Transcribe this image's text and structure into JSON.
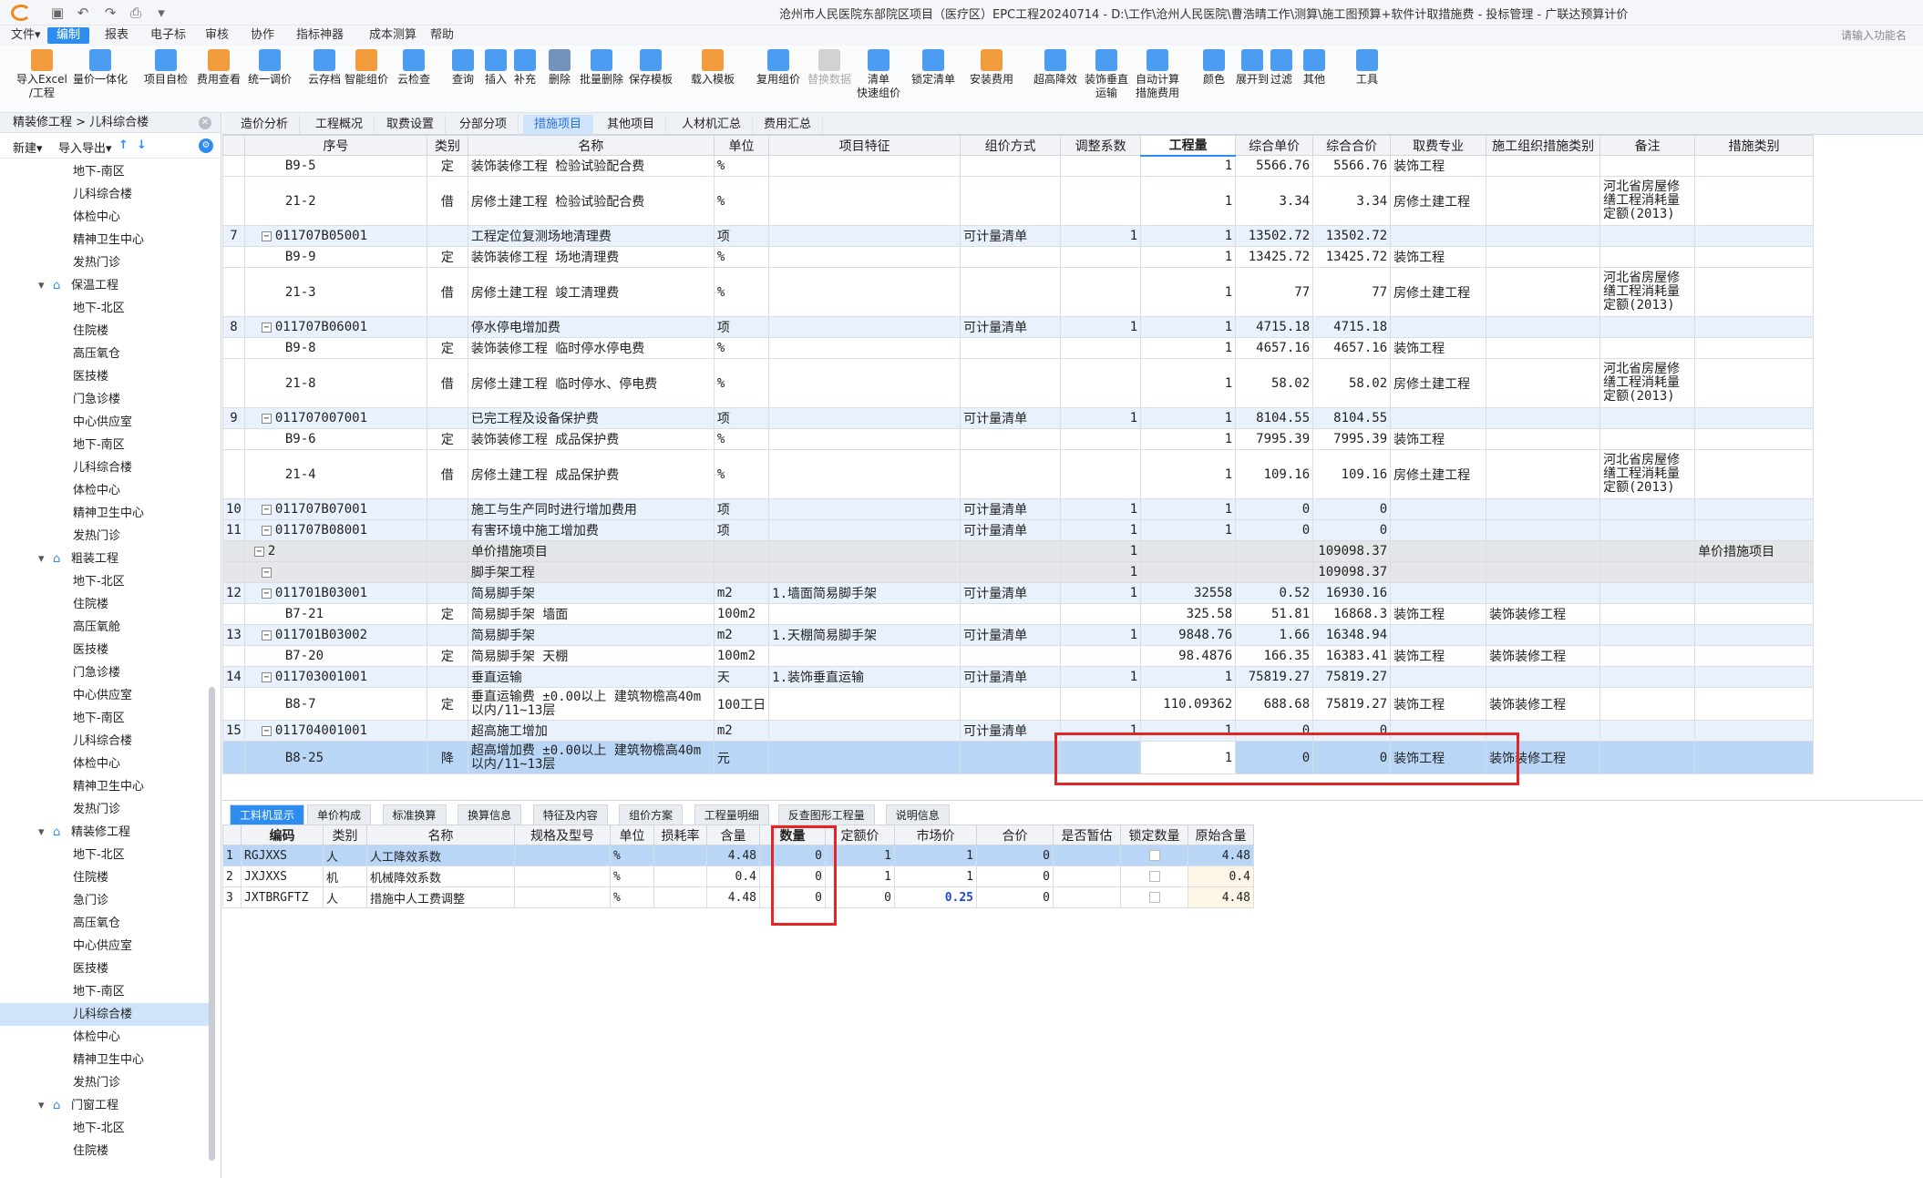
{
  "window": {
    "title": "沧州市人民医院东部院区项目（医疗区）EPC工程20240714 - D:\\工作\\沧州人民医院\\曹浩晴工作\\测算\\施工图预算+软件计取措施费 - 投标管理 - 广联达预算计价",
    "search_placeholder": "请输入功能名"
  },
  "colors": {
    "accent": "#2d8cf0",
    "highlight": "#e32525",
    "selected_row": "#b9d6f6",
    "list_row": "#e8f1fc"
  },
  "menu": [
    "文件▾",
    "编制",
    "报表",
    "电子标",
    "审核",
    "协作",
    "指标神器",
    "成本测算",
    "帮助"
  ],
  "ribbon": [
    {
      "label": "导入Excel",
      "label2": "/工程",
      "icon": "import-icon"
    },
    {
      "label": "量价一体化",
      "label2": "",
      "icon": "qty-price-icon"
    },
    {
      "label": "项目自检",
      "label2": "",
      "icon": "self-check-icon"
    },
    {
      "label": "费用查看",
      "label2": "",
      "icon": "fee-view-icon"
    },
    {
      "label": "统一调价",
      "label2": "",
      "icon": "unify-price-icon"
    },
    {
      "label": "云存档",
      "label2": "",
      "icon": "cloud-save-icon"
    },
    {
      "label": "智能组价",
      "label2": "",
      "icon": "smart-price-icon"
    },
    {
      "label": "云检查",
      "label2": "",
      "icon": "cloud-check-icon"
    },
    {
      "label": "查询",
      "label2": "",
      "icon": "query-icon"
    },
    {
      "label": "插入",
      "label2": "",
      "icon": "insert-icon"
    },
    {
      "label": "补充",
      "label2": "",
      "icon": "supplement-icon"
    },
    {
      "label": "删除",
      "label2": "",
      "icon": "delete-icon"
    },
    {
      "label": "批量删除",
      "label2": "",
      "icon": "batch-delete-icon"
    },
    {
      "label": "保存模板",
      "label2": "",
      "icon": "save-template-icon"
    },
    {
      "label": "载入模板",
      "label2": "",
      "icon": "load-template-icon"
    },
    {
      "label": "复用组价",
      "label2": "",
      "icon": "reuse-price-icon"
    },
    {
      "label": "替换数据",
      "label2": "",
      "icon": "replace-data-icon",
      "disabled": true
    },
    {
      "label": "清单",
      "label2": "快速组价",
      "icon": "list-quick-icon"
    },
    {
      "label": "锁定清单",
      "label2": "",
      "icon": "lock-list-icon"
    },
    {
      "label": "安装费用",
      "label2": "",
      "icon": "install-fee-icon"
    },
    {
      "label": "超高降效",
      "label2": "",
      "icon": "height-reduce-icon"
    },
    {
      "label": "装饰垂直",
      "label2": "运输",
      "icon": "vertical-transport-icon"
    },
    {
      "label": "自动计算",
      "label2": "措施费用",
      "icon": "auto-calc-icon"
    },
    {
      "label": "颜色",
      "label2": "",
      "icon": "color-icon"
    },
    {
      "label": "展开到",
      "label2": "",
      "icon": "expand-to-icon"
    },
    {
      "label": "过滤",
      "label2": "",
      "icon": "filter-icon"
    },
    {
      "label": "其他",
      "label2": "",
      "icon": "other-icon"
    },
    {
      "label": "工具",
      "label2": "",
      "icon": "tools-icon"
    }
  ],
  "left": {
    "breadcrumb": "精装修工程 > 儿科综合楼",
    "new_label": "新建▾",
    "import_export_label": "导入导出▾",
    "tree": [
      {
        "label": "地下-南区",
        "level": 2
      },
      {
        "label": "儿科综合楼",
        "level": 2
      },
      {
        "label": "体检中心",
        "level": 2
      },
      {
        "label": "精神卫生中心",
        "level": 2
      },
      {
        "label": "发热门诊",
        "level": 2
      },
      {
        "label": "保温工程",
        "level": 1
      },
      {
        "label": "地下-北区",
        "level": 2
      },
      {
        "label": "住院楼",
        "level": 2
      },
      {
        "label": "高压氧仓",
        "level": 2
      },
      {
        "label": "医技楼",
        "level": 2
      },
      {
        "label": "门急诊楼",
        "level": 2
      },
      {
        "label": "中心供应室",
        "level": 2
      },
      {
        "label": "地下-南区",
        "level": 2
      },
      {
        "label": "儿科综合楼",
        "level": 2
      },
      {
        "label": "体检中心",
        "level": 2
      },
      {
        "label": "精神卫生中心",
        "level": 2
      },
      {
        "label": "发热门诊",
        "level": 2
      },
      {
        "label": "粗装工程",
        "level": 1
      },
      {
        "label": "地下-北区",
        "level": 2
      },
      {
        "label": "住院楼",
        "level": 2
      },
      {
        "label": "高压氧舱",
        "level": 2
      },
      {
        "label": "医技楼",
        "level": 2
      },
      {
        "label": "门急诊楼",
        "level": 2
      },
      {
        "label": "中心供应室",
        "level": 2
      },
      {
        "label": "地下-南区",
        "level": 2
      },
      {
        "label": "儿科综合楼",
        "level": 2
      },
      {
        "label": "体检中心",
        "level": 2
      },
      {
        "label": "精神卫生中心",
        "level": 2
      },
      {
        "label": "发热门诊",
        "level": 2
      },
      {
        "label": "精装修工程",
        "level": 1
      },
      {
        "label": "地下-北区",
        "level": 2
      },
      {
        "label": "住院楼",
        "level": 2
      },
      {
        "label": "急门诊",
        "level": 2
      },
      {
        "label": "高压氧仓",
        "level": 2
      },
      {
        "label": "中心供应室",
        "level": 2
      },
      {
        "label": "医技楼",
        "level": 2
      },
      {
        "label": "地下-南区",
        "level": 2
      },
      {
        "label": "儿科综合楼",
        "level": 2,
        "selected": true
      },
      {
        "label": "体检中心",
        "level": 2
      },
      {
        "label": "精神卫生中心",
        "level": 2
      },
      {
        "label": "发热门诊",
        "level": 2
      },
      {
        "label": "门窗工程",
        "level": 1
      },
      {
        "label": "地下-北区",
        "level": 2
      },
      {
        "label": "住院楼",
        "level": 2
      }
    ]
  },
  "tabs": [
    "造价分析",
    "工程概况",
    "取费设置",
    "分部分项",
    "措施项目",
    "其他项目",
    "人材机汇总",
    "费用汇总"
  ],
  "active_tab": 4,
  "grid": {
    "headers": [
      "序号",
      "类别",
      "名称",
      "单位",
      "项目特征",
      "组价方式",
      "调整系数",
      "工程量",
      "综合单价",
      "综合合价",
      "取费专业",
      "施工组织措施类别",
      "备注",
      "措施类别"
    ],
    "rows": [
      {
        "type": "item",
        "seq": "",
        "code": "B9-5",
        "cat": "定",
        "name": "装饰装修工程 检验试验配合费",
        "unit": "%",
        "feat": "",
        "method": "",
        "coef": "",
        "qty": "1",
        "uprice": "5566.76",
        "total": "5566.76",
        "major": "装饰工程",
        "org": "",
        "note": "",
        "mcat": ""
      },
      {
        "type": "item",
        "seq": "",
        "code": "21-2",
        "cat": "借",
        "name": "房修土建工程 检验试验配合费",
        "unit": "%",
        "feat": "",
        "method": "",
        "coef": "",
        "qty": "1",
        "uprice": "3.34",
        "total": "3.34",
        "major": "房修土建工程",
        "org": "",
        "note": "河北省房屋修缮工程消耗量定额(2013)",
        "mcat": "",
        "tall": true
      },
      {
        "type": "list",
        "seq": "7",
        "code": "011707B05001",
        "cat": "",
        "name": "工程定位复测场地清理费",
        "unit": "项",
        "feat": "",
        "method": "可计量清单",
        "coef": "1",
        "qty": "1",
        "uprice": "13502.72",
        "total": "13502.72",
        "major": "",
        "org": "",
        "note": "",
        "mcat": ""
      },
      {
        "type": "item",
        "seq": "",
        "code": "B9-9",
        "cat": "定",
        "name": "装饰装修工程 场地清理费",
        "unit": "%",
        "feat": "",
        "method": "",
        "coef": "",
        "qty": "1",
        "uprice": "13425.72",
        "total": "13425.72",
        "major": "装饰工程",
        "org": "",
        "note": "",
        "mcat": ""
      },
      {
        "type": "item",
        "seq": "",
        "code": "21-3",
        "cat": "借",
        "name": "房修土建工程 竣工清理费",
        "unit": "%",
        "feat": "",
        "method": "",
        "coef": "",
        "qty": "1",
        "uprice": "77",
        "total": "77",
        "major": "房修土建工程",
        "org": "",
        "note": "河北省房屋修缮工程消耗量定额(2013)",
        "mcat": "",
        "tall": true
      },
      {
        "type": "list",
        "seq": "8",
        "code": "011707B06001",
        "cat": "",
        "name": "停水停电增加费",
        "unit": "项",
        "feat": "",
        "method": "可计量清单",
        "coef": "1",
        "qty": "1",
        "uprice": "4715.18",
        "total": "4715.18",
        "major": "",
        "org": "",
        "note": "",
        "mcat": ""
      },
      {
        "type": "item",
        "seq": "",
        "code": "B9-8",
        "cat": "定",
        "name": "装饰装修工程 临时停水停电费",
        "unit": "%",
        "feat": "",
        "method": "",
        "coef": "",
        "qty": "1",
        "uprice": "4657.16",
        "total": "4657.16",
        "major": "装饰工程",
        "org": "",
        "note": "",
        "mcat": ""
      },
      {
        "type": "item",
        "seq": "",
        "code": "21-8",
        "cat": "借",
        "name": "房修土建工程 临时停水、停电费",
        "unit": "%",
        "feat": "",
        "method": "",
        "coef": "",
        "qty": "1",
        "uprice": "58.02",
        "total": "58.02",
        "major": "房修土建工程",
        "org": "",
        "note": "河北省房屋修缮工程消耗量定额(2013)",
        "mcat": "",
        "tall": true
      },
      {
        "type": "list",
        "seq": "9",
        "code": "011707007001",
        "cat": "",
        "name": "已完工程及设备保护费",
        "unit": "项",
        "feat": "",
        "method": "可计量清单",
        "coef": "1",
        "qty": "1",
        "uprice": "8104.55",
        "total": "8104.55",
        "major": "",
        "org": "",
        "note": "",
        "mcat": ""
      },
      {
        "type": "item",
        "seq": "",
        "code": "B9-6",
        "cat": "定",
        "name": "装饰装修工程 成品保护费",
        "unit": "%",
        "feat": "",
        "method": "",
        "coef": "",
        "qty": "1",
        "uprice": "7995.39",
        "total": "7995.39",
        "major": "装饰工程",
        "org": "",
        "note": "",
        "mcat": ""
      },
      {
        "type": "item",
        "seq": "",
        "code": "21-4",
        "cat": "借",
        "name": "房修土建工程 成品保护费",
        "unit": "%",
        "feat": "",
        "method": "",
        "coef": "",
        "qty": "1",
        "uprice": "109.16",
        "total": "109.16",
        "major": "房修土建工程",
        "org": "",
        "note": "河北省房屋修缮工程消耗量定额(2013)",
        "mcat": "",
        "tall": true
      },
      {
        "type": "list",
        "seq": "10",
        "code": "011707B07001",
        "cat": "",
        "name": "施工与生产同时进行增加费用",
        "unit": "项",
        "feat": "",
        "method": "可计量清单",
        "coef": "1",
        "qty": "1",
        "uprice": "0",
        "total": "0",
        "major": "",
        "org": "",
        "note": "",
        "mcat": ""
      },
      {
        "type": "list",
        "seq": "11",
        "code": "011707B08001",
        "cat": "",
        "name": "有害环境中施工增加费",
        "unit": "项",
        "feat": "",
        "method": "可计量清单",
        "coef": "1",
        "qty": "1",
        "uprice": "0",
        "total": "0",
        "major": "",
        "org": "",
        "note": "",
        "mcat": ""
      },
      {
        "type": "grp",
        "seq": "",
        "code": "2",
        "cat": "",
        "name": "单价措施项目",
        "unit": "",
        "feat": "",
        "method": "",
        "coef": "1",
        "qty": "",
        "uprice": "",
        "total": "109098.37",
        "major": "",
        "org": "",
        "note": "",
        "mcat": "单价措施项目"
      },
      {
        "type": "grp",
        "seq": "",
        "code": "",
        "cat": "",
        "name": "脚手架工程",
        "unit": "",
        "feat": "",
        "method": "",
        "coef": "1",
        "qty": "",
        "uprice": "",
        "total": "109098.37",
        "major": "",
        "org": "",
        "note": "",
        "mcat": ""
      },
      {
        "type": "list",
        "seq": "12",
        "code": "011701B03001",
        "cat": "",
        "name": "简易脚手架",
        "unit": "m2",
        "feat": "1.墙面简易脚手架",
        "method": "可计量清单",
        "coef": "1",
        "qty": "32558",
        "uprice": "0.52",
        "total": "16930.16",
        "major": "",
        "org": "",
        "note": "",
        "mcat": ""
      },
      {
        "type": "item",
        "seq": "",
        "code": "B7-21",
        "cat": "定",
        "name": "简易脚手架 墙面",
        "unit": "100m2",
        "feat": "",
        "method": "",
        "coef": "",
        "qty": "325.58",
        "uprice": "51.81",
        "total": "16868.3",
        "major": "装饰工程",
        "org": "装饰装修工程",
        "note": "",
        "mcat": ""
      },
      {
        "type": "list",
        "seq": "13",
        "code": "011701B03002",
        "cat": "",
        "name": "简易脚手架",
        "unit": "m2",
        "feat": "1.天棚简易脚手架",
        "method": "可计量清单",
        "coef": "1",
        "qty": "9848.76",
        "uprice": "1.66",
        "total": "16348.94",
        "major": "",
        "org": "",
        "note": "",
        "mcat": ""
      },
      {
        "type": "item",
        "seq": "",
        "code": "B7-20",
        "cat": "定",
        "name": "简易脚手架 天棚",
        "unit": "100m2",
        "feat": "",
        "method": "",
        "coef": "",
        "qty": "98.4876",
        "uprice": "166.35",
        "total": "16383.41",
        "major": "装饰工程",
        "org": "装饰装修工程",
        "note": "",
        "mcat": ""
      },
      {
        "type": "list",
        "seq": "14",
        "code": "011703001001",
        "cat": "",
        "name": "垂直运输",
        "unit": "天",
        "feat": "1.装饰垂直运输",
        "method": "可计量清单",
        "coef": "1",
        "qty": "1",
        "uprice": "75819.27",
        "total": "75819.27",
        "major": "",
        "org": "",
        "note": "",
        "mcat": ""
      },
      {
        "type": "item",
        "seq": "",
        "code": "B8-7",
        "cat": "定",
        "name": "垂直运输费 ±0.00以上 建筑物檐高40m以内/11~13层",
        "unit": "100工日",
        "feat": "",
        "method": "",
        "coef": "",
        "qty": "110.09362",
        "uprice": "688.68",
        "total": "75819.27",
        "major": "装饰工程",
        "org": "装饰装修工程",
        "note": "",
        "mcat": "",
        "tall2": true
      },
      {
        "type": "list",
        "seq": "15",
        "code": "011704001001",
        "cat": "",
        "name": "超高施工增加",
        "unit": "m2",
        "feat": "",
        "method": "可计量清单",
        "coef": "1",
        "qty": "1",
        "uprice": "0",
        "total": "0",
        "major": "",
        "org": "",
        "note": "",
        "mcat": ""
      },
      {
        "type": "sel",
        "seq": "",
        "code": "B8-25",
        "cat": "降",
        "name": "超高增加费 ±0.00以上 建筑物檐高40m以内/11~13层",
        "unit": "元",
        "feat": "",
        "method": "",
        "coef": "",
        "qty": "1",
        "uprice": "0",
        "total": "0",
        "major": "装饰工程",
        "org": "装饰装修工程",
        "note": "",
        "mcat": "",
        "tall2": true
      }
    ]
  },
  "bottom": {
    "tabs": [
      "工料机显示",
      "单价构成",
      "标准换算",
      "换算信息",
      "特征及内容",
      "组价方案",
      "工程量明细",
      "反查图形工程量",
      "说明信息"
    ],
    "active_tab": 0,
    "headers": [
      "编码",
      "类别",
      "名称",
      "规格及型号",
      "单位",
      "损耗率",
      "含量",
      "数量",
      "定额价",
      "市场价",
      "合价",
      "是否暂估",
      "锁定数量",
      "原始含量"
    ],
    "rows": [
      {
        "no": "1",
        "code": "RGJXXS",
        "cat": "人",
        "name": "人工降效系数",
        "spec": "",
        "unit": "%",
        "loss": "",
        "content": "4.48",
        "qty": "0",
        "dprice": "1",
        "mprice": "1",
        "total": "0",
        "orig": "4.48",
        "blue": false
      },
      {
        "no": "2",
        "code": "JXJXXS",
        "cat": "机",
        "name": "机械降效系数",
        "spec": "",
        "unit": "%",
        "loss": "",
        "content": "0.4",
        "qty": "0",
        "dprice": "1",
        "mprice": "1",
        "total": "0",
        "orig": "0.4",
        "blue": false
      },
      {
        "no": "3",
        "code": "JXTBRGFTZ",
        "cat": "人",
        "name": "措施中人工费调整",
        "spec": "",
        "unit": "%",
        "loss": "",
        "content": "4.48",
        "qty": "0",
        "dprice": "0",
        "mprice": "0.25",
        "total": "0",
        "orig": "4.48",
        "blue": true
      }
    ]
  }
}
